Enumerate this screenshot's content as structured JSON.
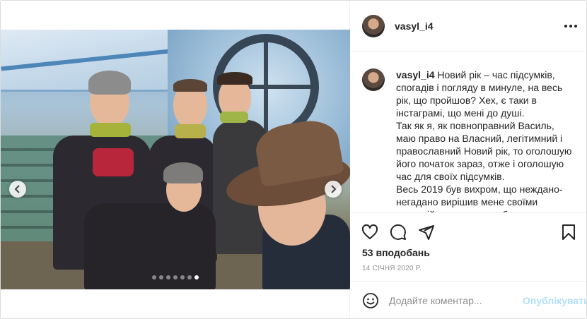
{
  "post": {
    "username": "vasyl_i4",
    "more_icon": "more-horizontal-icon"
  },
  "carousel": {
    "slide_count": 7,
    "active_index": 6,
    "prev_icon": "chevron-left-icon",
    "next_icon": "chevron-right-icon"
  },
  "caption": {
    "username": "vasyl_i4",
    "text": " Новий рік – час підсумків, спогадів і погляду в минуле, на весь рік, що пройшов? Хех, є таки в інстаграмі, що мені до душі.\nТак як я, як повноправний Василь, маю право на Власний, легітимний і православний Новий рік, то оголошую його початок зараз, отже і оголошую час для своїх підсумків.\nВесь 2019 був вихром, що неждано-негадано вирішив мене своїми неспокійними, непередбачуваними"
  },
  "actions": {
    "like_icon": "heart-icon",
    "comment_icon": "comment-icon",
    "share_icon": "share-icon",
    "save_icon": "bookmark-icon",
    "likes_text": "53 вподобань",
    "date_text": "14 січня 2020 р."
  },
  "comment_box": {
    "emoji_icon": "emoji-icon",
    "placeholder": "Додайте коментар...",
    "publish_label": "Опублікувати"
  },
  "colors": {
    "text": "#262626",
    "secondary_text": "#8e8e8e",
    "border": "#dbdbdb",
    "publish_disabled": "#b2dffc"
  }
}
